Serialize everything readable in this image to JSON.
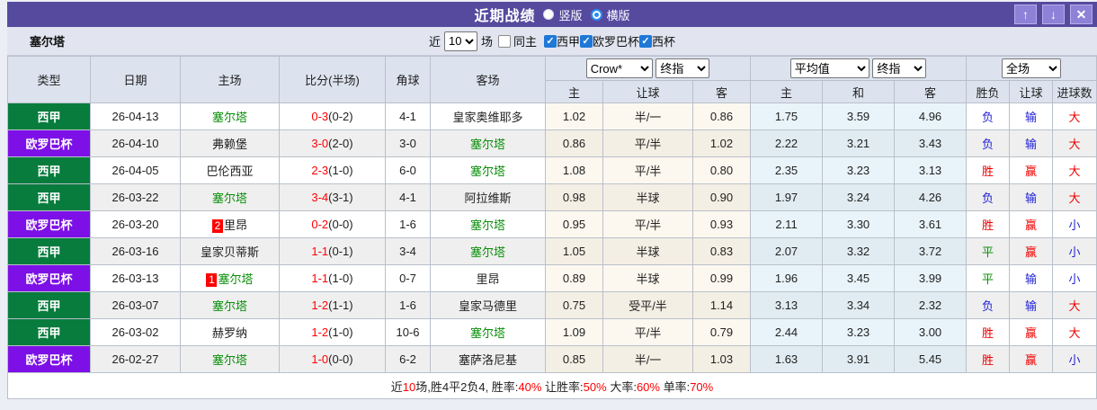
{
  "title_bar": {
    "title": "近期战绩",
    "layout_options": [
      {
        "label": "竖版",
        "selected": false
      },
      {
        "label": "横版",
        "selected": true
      }
    ],
    "up_button": "↑",
    "down_button": "↓",
    "close_button": "✕"
  },
  "filter_bar": {
    "team_name": "塞尔塔",
    "near_label": "近",
    "recent_count": "10",
    "matches_label": "场",
    "same_home_label": "同主",
    "league_filters": [
      {
        "label": "西甲",
        "checked": true
      },
      {
        "label": "欧罗巴杯",
        "checked": true
      },
      {
        "label": "西杯",
        "checked": true
      }
    ]
  },
  "table": {
    "column_headers": {
      "type": "类型",
      "date": "日期",
      "home": "主场",
      "score": "比分(半场)",
      "corner": "角球",
      "away": "客场"
    },
    "selects": {
      "bookmaker": "Crow*",
      "bookmaker_index": "终指",
      "average": "平均值",
      "average_index": "终指",
      "full_match": "全场"
    },
    "sub_headers": [
      "主",
      "让球",
      "客",
      "主",
      "和",
      "客",
      "胜负",
      "让球",
      "进球数"
    ],
    "rows": [
      {
        "league": "西甲",
        "date": "26-04-13",
        "home": "塞尔塔",
        "home_green": true,
        "home_rank": "",
        "score": "0-3",
        "half": "(0-2)",
        "corner": "4-1",
        "away": "皇家奥维耶多",
        "away_green": false,
        "away_rank": "",
        "crow": [
          "1.02",
          "半/一",
          "0.86"
        ],
        "avg": [
          "1.75",
          "3.59",
          "4.96"
        ],
        "results": [
          {
            "t": "负",
            "c": "blue"
          },
          {
            "t": "输",
            "c": "blue"
          },
          {
            "t": "大",
            "c": "red"
          }
        ]
      },
      {
        "league": "欧罗巴杯",
        "date": "26-04-10",
        "home": "弗赖堡",
        "home_green": false,
        "home_rank": "",
        "score": "3-0",
        "half": "(2-0)",
        "corner": "3-0",
        "away": "塞尔塔",
        "away_green": true,
        "away_rank": "",
        "crow": [
          "0.86",
          "平/半",
          "1.02"
        ],
        "avg": [
          "2.22",
          "3.21",
          "3.43"
        ],
        "results": [
          {
            "t": "负",
            "c": "blue"
          },
          {
            "t": "输",
            "c": "blue"
          },
          {
            "t": "大",
            "c": "red"
          }
        ]
      },
      {
        "league": "西甲",
        "date": "26-04-05",
        "home": "巴伦西亚",
        "home_green": false,
        "home_rank": "",
        "score": "2-3",
        "half": "(1-0)",
        "corner": "6-0",
        "away": "塞尔塔",
        "away_green": true,
        "away_rank": "",
        "crow": [
          "1.08",
          "平/半",
          "0.80"
        ],
        "avg": [
          "2.35",
          "3.23",
          "3.13"
        ],
        "results": [
          {
            "t": "胜",
            "c": "red"
          },
          {
            "t": "赢",
            "c": "red"
          },
          {
            "t": "大",
            "c": "red"
          }
        ]
      },
      {
        "league": "西甲",
        "date": "26-03-22",
        "home": "塞尔塔",
        "home_green": true,
        "home_rank": "",
        "score": "3-4",
        "half": "(3-1)",
        "corner": "4-1",
        "away": "阿拉维斯",
        "away_green": false,
        "away_rank": "",
        "crow": [
          "0.98",
          "半球",
          "0.90"
        ],
        "avg": [
          "1.97",
          "3.24",
          "4.26"
        ],
        "results": [
          {
            "t": "负",
            "c": "blue"
          },
          {
            "t": "输",
            "c": "blue"
          },
          {
            "t": "大",
            "c": "red"
          }
        ]
      },
      {
        "league": "欧罗巴杯",
        "date": "26-03-20",
        "home": "里昂",
        "home_green": false,
        "home_rank": "2",
        "score": "0-2",
        "half": "(0-0)",
        "corner": "1-6",
        "away": "塞尔塔",
        "away_green": true,
        "away_rank": "",
        "crow": [
          "0.95",
          "平/半",
          "0.93"
        ],
        "avg": [
          "2.11",
          "3.30",
          "3.61"
        ],
        "results": [
          {
            "t": "胜",
            "c": "red"
          },
          {
            "t": "赢",
            "c": "red"
          },
          {
            "t": "小",
            "c": "blue"
          }
        ]
      },
      {
        "league": "西甲",
        "date": "26-03-16",
        "home": "皇家贝蒂斯",
        "home_green": false,
        "home_rank": "",
        "score": "1-1",
        "half": "(0-1)",
        "corner": "3-4",
        "away": "塞尔塔",
        "away_green": true,
        "away_rank": "",
        "crow": [
          "1.05",
          "半球",
          "0.83"
        ],
        "avg": [
          "2.07",
          "3.32",
          "3.72"
        ],
        "results": [
          {
            "t": "平",
            "c": "green"
          },
          {
            "t": "赢",
            "c": "red"
          },
          {
            "t": "小",
            "c": "blue"
          }
        ]
      },
      {
        "league": "欧罗巴杯",
        "date": "26-03-13",
        "home": "塞尔塔",
        "home_green": true,
        "home_rank": "1",
        "score": "1-1",
        "half": "(1-0)",
        "corner": "0-7",
        "away": "里昂",
        "away_green": false,
        "away_rank": "",
        "crow": [
          "0.89",
          "半球",
          "0.99"
        ],
        "avg": [
          "1.96",
          "3.45",
          "3.99"
        ],
        "results": [
          {
            "t": "平",
            "c": "green"
          },
          {
            "t": "输",
            "c": "blue"
          },
          {
            "t": "小",
            "c": "blue"
          }
        ]
      },
      {
        "league": "西甲",
        "date": "26-03-07",
        "home": "塞尔塔",
        "home_green": true,
        "home_rank": "",
        "score": "1-2",
        "half": "(1-1)",
        "corner": "1-6",
        "away": "皇家马德里",
        "away_green": false,
        "away_rank": "",
        "crow": [
          "0.75",
          "受平/半",
          "1.14"
        ],
        "avg": [
          "3.13",
          "3.34",
          "2.32"
        ],
        "results": [
          {
            "t": "负",
            "c": "blue"
          },
          {
            "t": "输",
            "c": "blue"
          },
          {
            "t": "大",
            "c": "red"
          }
        ]
      },
      {
        "league": "西甲",
        "date": "26-03-02",
        "home": "赫罗纳",
        "home_green": false,
        "home_rank": "",
        "score": "1-2",
        "half": "(1-0)",
        "corner": "10-6",
        "away": "塞尔塔",
        "away_green": true,
        "away_rank": "",
        "crow": [
          "1.09",
          "平/半",
          "0.79"
        ],
        "avg": [
          "2.44",
          "3.23",
          "3.00"
        ],
        "results": [
          {
            "t": "胜",
            "c": "red"
          },
          {
            "t": "赢",
            "c": "red"
          },
          {
            "t": "大",
            "c": "red"
          }
        ]
      },
      {
        "league": "欧罗巴杯",
        "date": "26-02-27",
        "home": "塞尔塔",
        "home_green": true,
        "home_rank": "",
        "score": "1-0",
        "half": "(0-0)",
        "corner": "6-2",
        "away": "塞萨洛尼基",
        "away_green": false,
        "away_rank": "",
        "crow": [
          "0.85",
          "半/一",
          "1.03"
        ],
        "avg": [
          "1.63",
          "3.91",
          "5.45"
        ],
        "results": [
          {
            "t": "胜",
            "c": "red"
          },
          {
            "t": "赢",
            "c": "red"
          },
          {
            "t": "小",
            "c": "blue"
          }
        ]
      }
    ]
  },
  "summary": {
    "segments": [
      {
        "t": "近",
        "red": false
      },
      {
        "t": "10",
        "red": true
      },
      {
        "t": "场,胜4平2负4, 胜率:",
        "red": false
      },
      {
        "t": "40%",
        "red": true
      },
      {
        "t": " 让胜率:",
        "red": false
      },
      {
        "t": "50%",
        "red": true
      },
      {
        "t": " 大率:",
        "red": false
      },
      {
        "t": "60%",
        "red": true
      },
      {
        "t": " 单率:",
        "red": false
      },
      {
        "t": "70%",
        "red": true
      }
    ]
  },
  "colors": {
    "league": {
      "西甲": "#077c3d",
      "欧罗巴杯": "#7d10e6"
    },
    "titlebar_purple": "#564a9f",
    "result_red": "#ee0000",
    "result_blue": "#2222d6",
    "result_green": "#0b8f0b"
  }
}
